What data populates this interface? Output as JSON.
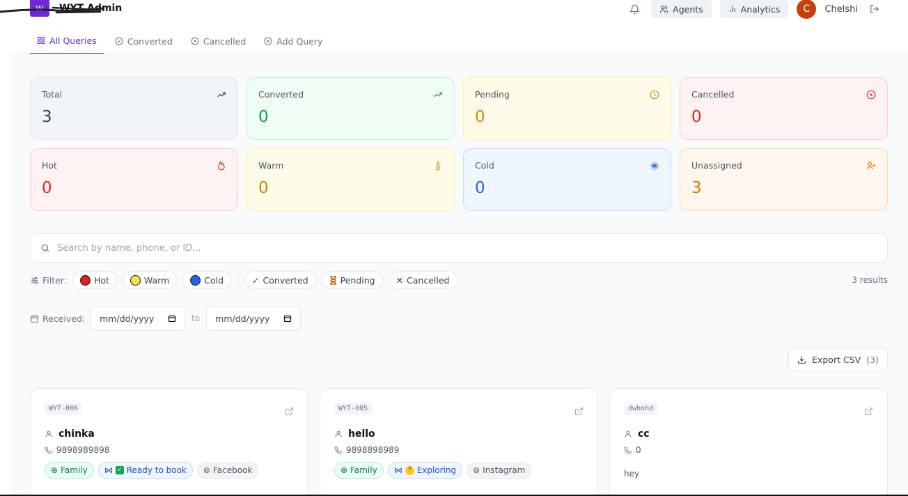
{
  "header": {
    "brand_name": "WYT Admin",
    "brand_logo": "W",
    "agents_label": "Agents",
    "analytics_label": "Analytics",
    "avatar_initial": "C",
    "user_name": "Chelshi"
  },
  "tabs": [
    {
      "label": "All Queries",
      "icon": "grid-icon",
      "active": true
    },
    {
      "label": "Converted",
      "icon": "check-circle-icon"
    },
    {
      "label": "Cancelled",
      "icon": "x-circle-icon"
    },
    {
      "label": "Add Query",
      "icon": "plus-circle-icon"
    }
  ],
  "stats": [
    {
      "label": "Total",
      "value": "3",
      "icon": "trending-up-icon",
      "color": "#374151"
    },
    {
      "label": "Converted",
      "value": "0",
      "icon": "trending-up-icon",
      "color": "#16a34a"
    },
    {
      "label": "Pending",
      "value": "0",
      "icon": "clock-icon",
      "color": "#ca8a04"
    },
    {
      "label": "Cancelled",
      "value": "0",
      "icon": "x-circle-icon",
      "color": "#dc2626"
    },
    {
      "label": "Hot",
      "value": "0",
      "icon": "flame-icon",
      "color": "#dc2626"
    },
    {
      "label": "Warm",
      "value": "0",
      "icon": "thermometer-icon",
      "color": "#ca8a04"
    },
    {
      "label": "Cold",
      "value": "0",
      "icon": "snowflake-icon",
      "color": "#2563eb"
    },
    {
      "label": "Unassigned",
      "value": "3",
      "icon": "user-plus-icon",
      "color": "#d97706"
    }
  ],
  "search": {
    "placeholder": "Search by name, phone, or ID..."
  },
  "filters": {
    "label": "Filter:",
    "chips": [
      "Hot",
      "Warm",
      "Cold",
      "Converted",
      "Pending",
      "Cancelled"
    ],
    "results": "3 results"
  },
  "dates": {
    "label": "Received:",
    "from_placeholder": "mm/dd/yyyy",
    "to_label": "to",
    "to_placeholder": "mm/dd/yyyy"
  },
  "export": {
    "label": "Export CSV",
    "count": "(3)"
  },
  "cards": [
    {
      "id": "WYT-006",
      "name": "chinka",
      "phone": "9898989898",
      "tags": [
        "Family",
        "Ready to book",
        "Facebook"
      ]
    },
    {
      "id": "WYT-005",
      "name": "hello",
      "phone": "9898898989",
      "tags": [
        "Family",
        "Exploring",
        "Instagram"
      ]
    },
    {
      "id": "dwhohd",
      "name": "cc",
      "phone": "0",
      "message": "hey"
    }
  ],
  "colors": {
    "accent": "#7c3aed",
    "avatar": "#c2410c"
  }
}
